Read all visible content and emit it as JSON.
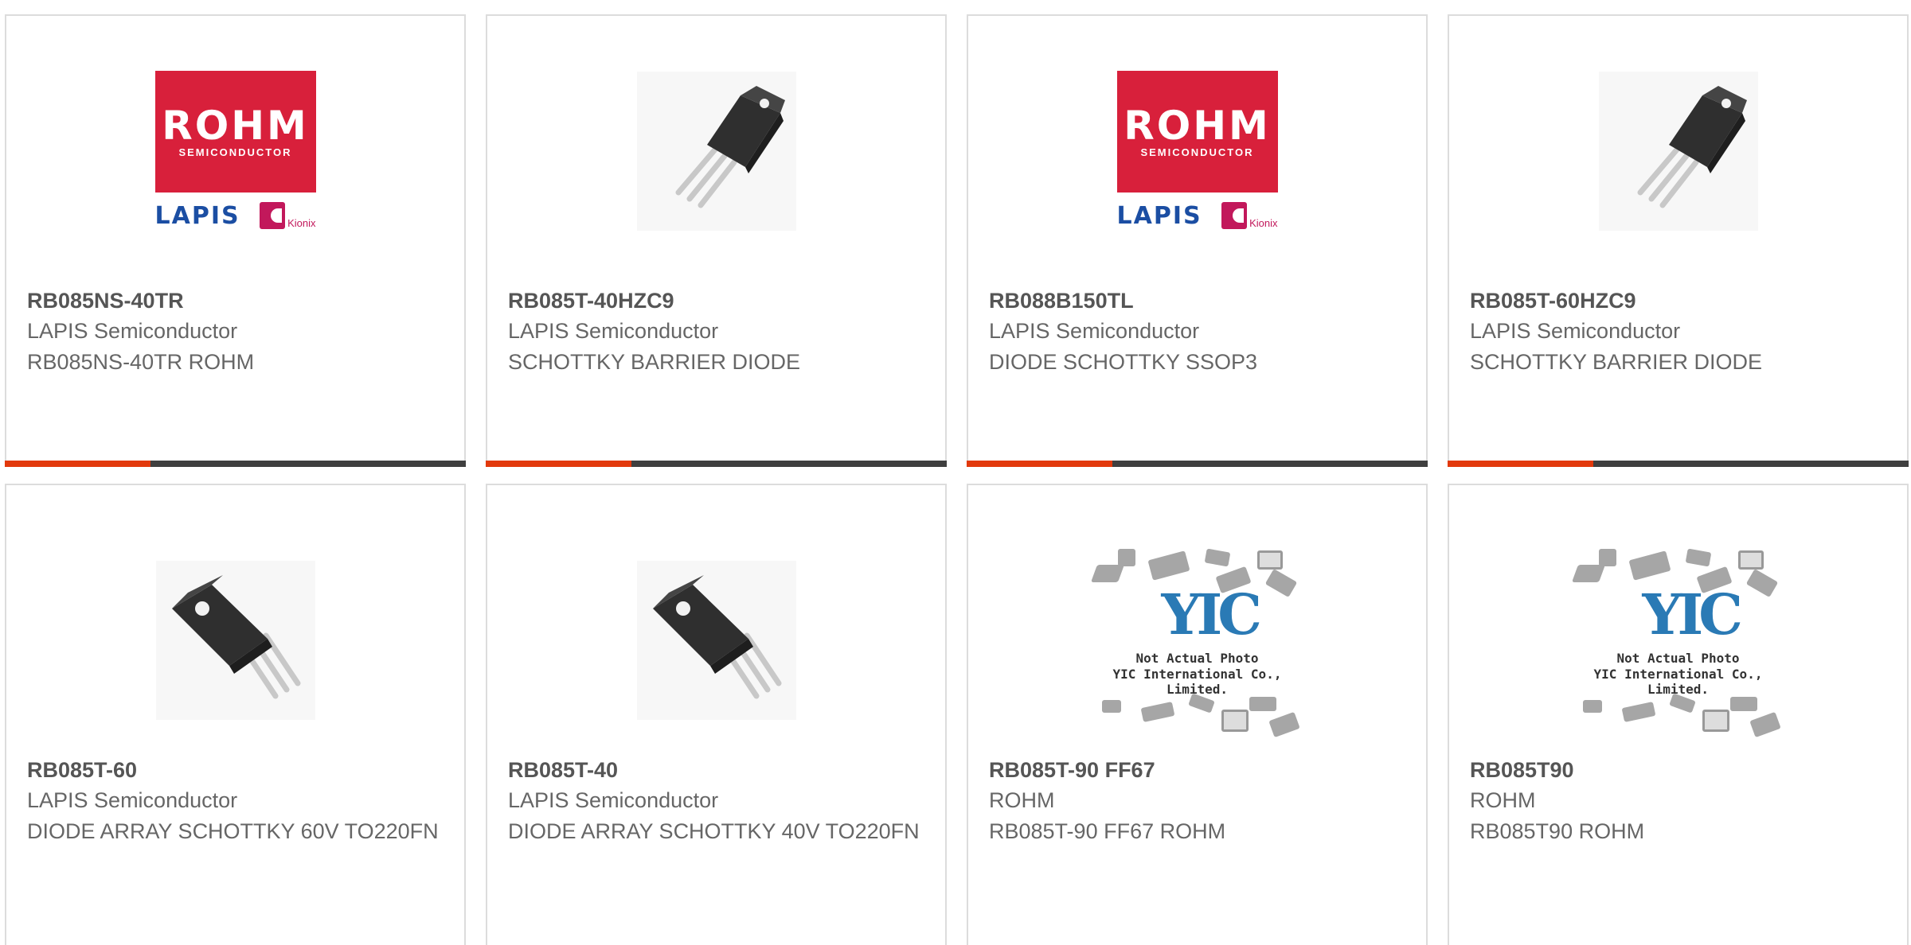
{
  "cards": [
    {
      "part": "RB085NS-40TR",
      "manufacturer": "LAPIS Semiconductor",
      "description": "RB085NS-40TR ROHM",
      "image": "rohm-lapis-logo"
    },
    {
      "part": "RB085T-40HZC9",
      "manufacturer": "LAPIS Semiconductor",
      "description": "SCHOTTKY BARRIER DIODE",
      "image": "to220-transistor"
    },
    {
      "part": "RB088B150TL",
      "manufacturer": "LAPIS Semiconductor",
      "description": "DIODE SCHOTTKY SSOP3",
      "image": "rohm-lapis-logo"
    },
    {
      "part": "RB085T-60HZC9",
      "manufacturer": "LAPIS Semiconductor",
      "description": "SCHOTTKY BARRIER DIODE",
      "image": "to220-transistor"
    },
    {
      "part": "RB085T-60",
      "manufacturer": "LAPIS Semiconductor",
      "description": "DIODE ARRAY SCHOTTKY 60V TO220FN",
      "image": "to220-transistor-large"
    },
    {
      "part": "RB085T-40",
      "manufacturer": "LAPIS Semiconductor",
      "description": "DIODE ARRAY SCHOTTKY 40V TO220FN",
      "image": "to220-transistor-large"
    },
    {
      "part": "RB085T-90 FF67",
      "manufacturer": "ROHM",
      "description": "RB085T-90 FF67 ROHM",
      "image": "yic-placeholder"
    },
    {
      "part": "RB085T90",
      "manufacturer": "ROHM",
      "description": "RB085T90 ROHM",
      "image": "yic-placeholder"
    }
  ],
  "logo": {
    "rohm": "ROHM",
    "semiconductor": "SEMICONDUCTOR",
    "lapis": "LAPIS",
    "kionix": "Kionix"
  },
  "placeholder": {
    "mark": "YIC",
    "line1": "Not Actual Photo",
    "line2": "YIC International Co., Limited."
  },
  "colors": {
    "accent": "#e2390c",
    "bar": "#3f3f3f",
    "rohm_red": "#d8203b",
    "lapis_blue": "#1b4ea3"
  }
}
